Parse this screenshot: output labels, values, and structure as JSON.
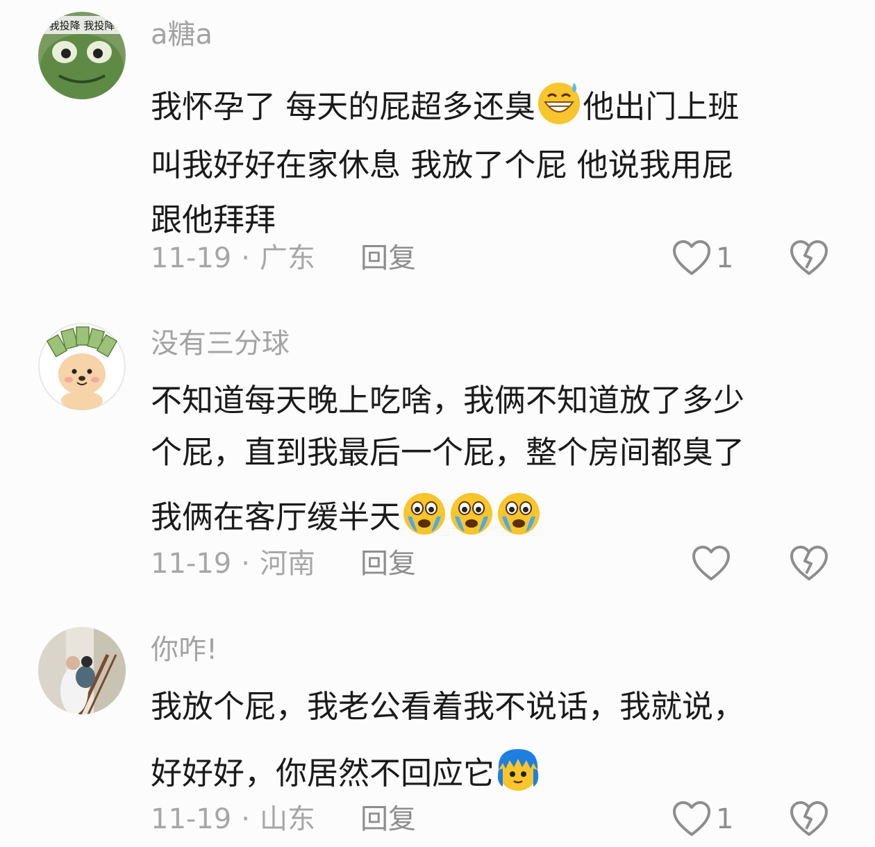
{
  "comments": [
    {
      "username": "a糖a",
      "lines": [
        {
          "text": "我怀孕了 每天的屁超多还臭",
          "emoji_after": "grinning-sweat-emoji",
          "tail": "他出门上班"
        },
        {
          "text": "叫我好好在家休息 我放了个屁 他说我用屁"
        },
        {
          "text": "跟他拜拜"
        }
      ],
      "date": "11-19",
      "separator": "·",
      "location": "广东",
      "reply_label": "回复",
      "like_count": "1",
      "avatar_caption": "我投降 我投降"
    },
    {
      "username": "没有三分球",
      "lines": [
        {
          "text": "不知道每天晚上吃啥，我俩不知道放了多少"
        },
        {
          "text": "个屁，直到我最后一个屁，整个房间都臭了"
        },
        {
          "text": "我俩在客厅缓半天",
          "emoji_after": "crying-emoji-x3"
        }
      ],
      "date": "11-19",
      "separator": "·",
      "location": "河南",
      "reply_label": "回复",
      "like_count": ""
    },
    {
      "username": "你咋!",
      "lines": [
        {
          "text": "我放个屁，我老公看着我不说话，我就说，"
        },
        {
          "text": "好好好，你居然不回应它",
          "emoji_after": "blue-hair-emoji"
        }
      ],
      "date": "11-19",
      "separator": "·",
      "location": "山东",
      "reply_label": "回复",
      "like_count": "1"
    }
  ],
  "colors": {
    "background": "#fcfcfc",
    "username": "#a3a3a3",
    "body_text": "#1a1a1a",
    "meta_text": "#a6a6a6",
    "icon": "#8d8d8d"
  }
}
